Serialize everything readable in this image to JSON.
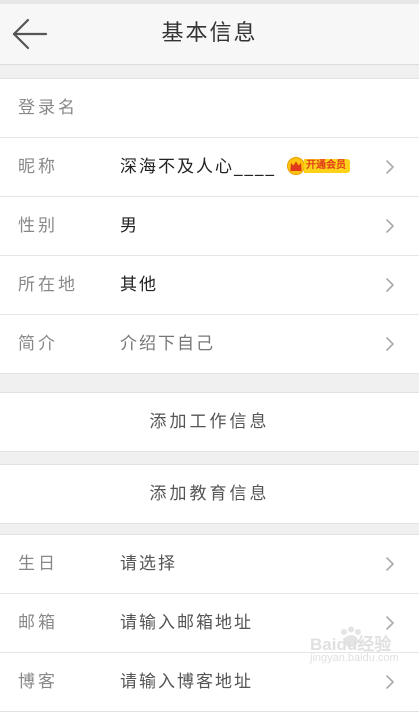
{
  "header": {
    "title": "基本信息",
    "back_icon": "arrow-left-icon"
  },
  "profile": {
    "rows": [
      {
        "label": "登录名",
        "value": "",
        "chevron": false
      },
      {
        "label": "昵称",
        "value": "深海不及人心____",
        "chevron": true
      },
      {
        "label": "性别",
        "value": "男",
        "chevron": true
      },
      {
        "label": "所在地",
        "value": "其他",
        "chevron": true
      },
      {
        "label": "简介",
        "value": "介绍下自己",
        "chevron": true
      }
    ],
    "vip_badge": {
      "label": "开通会员",
      "icon": "crown-icon",
      "color": "#ffd21a",
      "text_color": "#e03a1a"
    }
  },
  "actions": {
    "add_work": "添加工作信息",
    "add_education": "添加教育信息"
  },
  "extra": {
    "rows": [
      {
        "label": "生日",
        "value": "请选择",
        "chevron": true
      },
      {
        "label": "邮箱",
        "value": "请输入邮箱地址",
        "chevron": true
      },
      {
        "label": "博客",
        "value": "请输入博客地址",
        "chevron": true
      }
    ]
  },
  "watermark": {
    "text": "Baidu经验",
    "url": "jingyan.baidu.com"
  }
}
